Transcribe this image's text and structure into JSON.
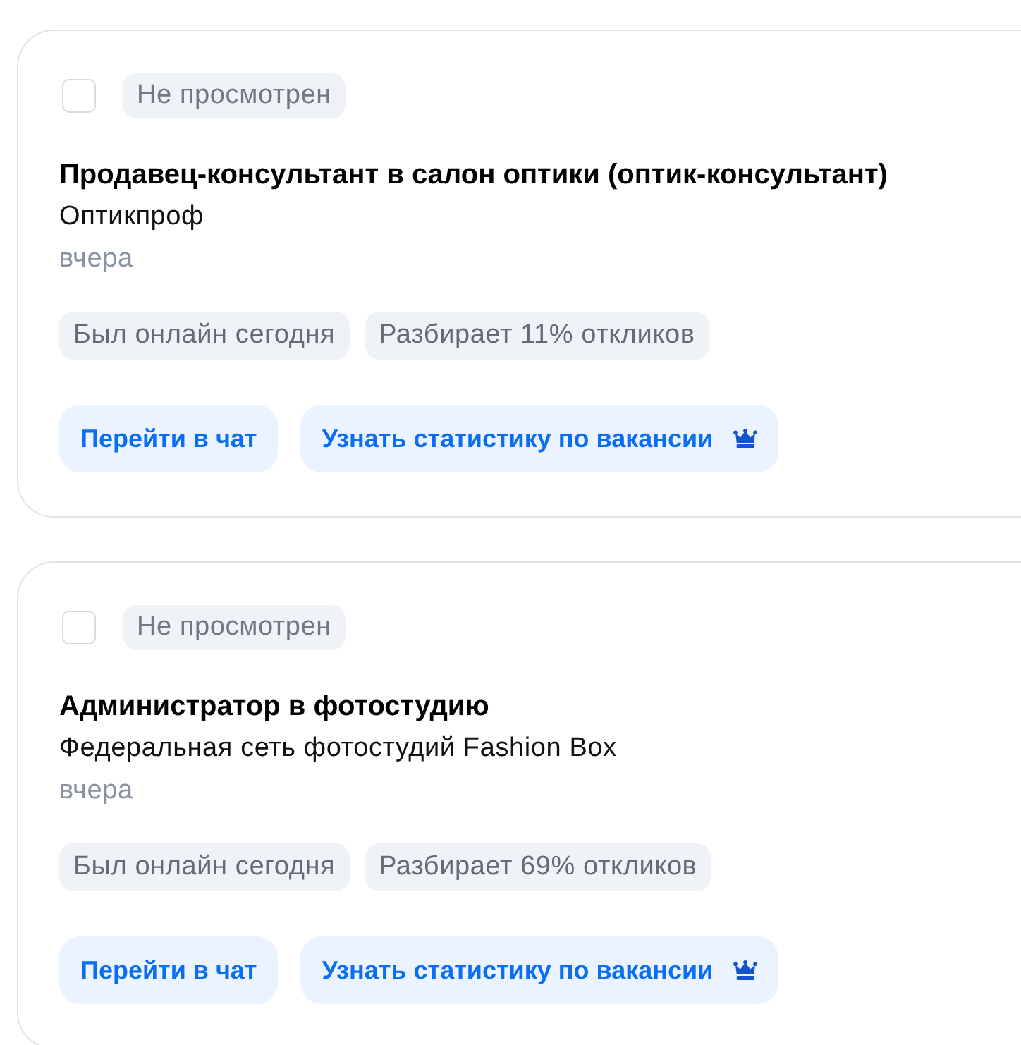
{
  "vacancies": [
    {
      "checked": false,
      "status": "Не просмотрен",
      "title": "Продавец-консультант в салон оптики (оптик-консультант)",
      "company": "Оптикпроф",
      "date": "вчера",
      "tags": [
        "Был онлайн сегодня",
        "Разбирает 11% откликов"
      ],
      "actions": [
        {
          "label": "Перейти в чат",
          "premium": false
        },
        {
          "label": "Узнать статистику по вакансии",
          "premium": true
        }
      ]
    },
    {
      "checked": false,
      "status": "Не просмотрен",
      "title": "Администратор в фотостудию",
      "company": "Федеральная сеть фотостудий Fashion Box",
      "date": "вчера",
      "tags": [
        "Был онлайн сегодня",
        "Разбирает 69% откликов"
      ],
      "actions": [
        {
          "label": "Перейти в чат",
          "premium": false
        },
        {
          "label": "Узнать статистику по вакансии",
          "premium": true
        }
      ]
    }
  ]
}
